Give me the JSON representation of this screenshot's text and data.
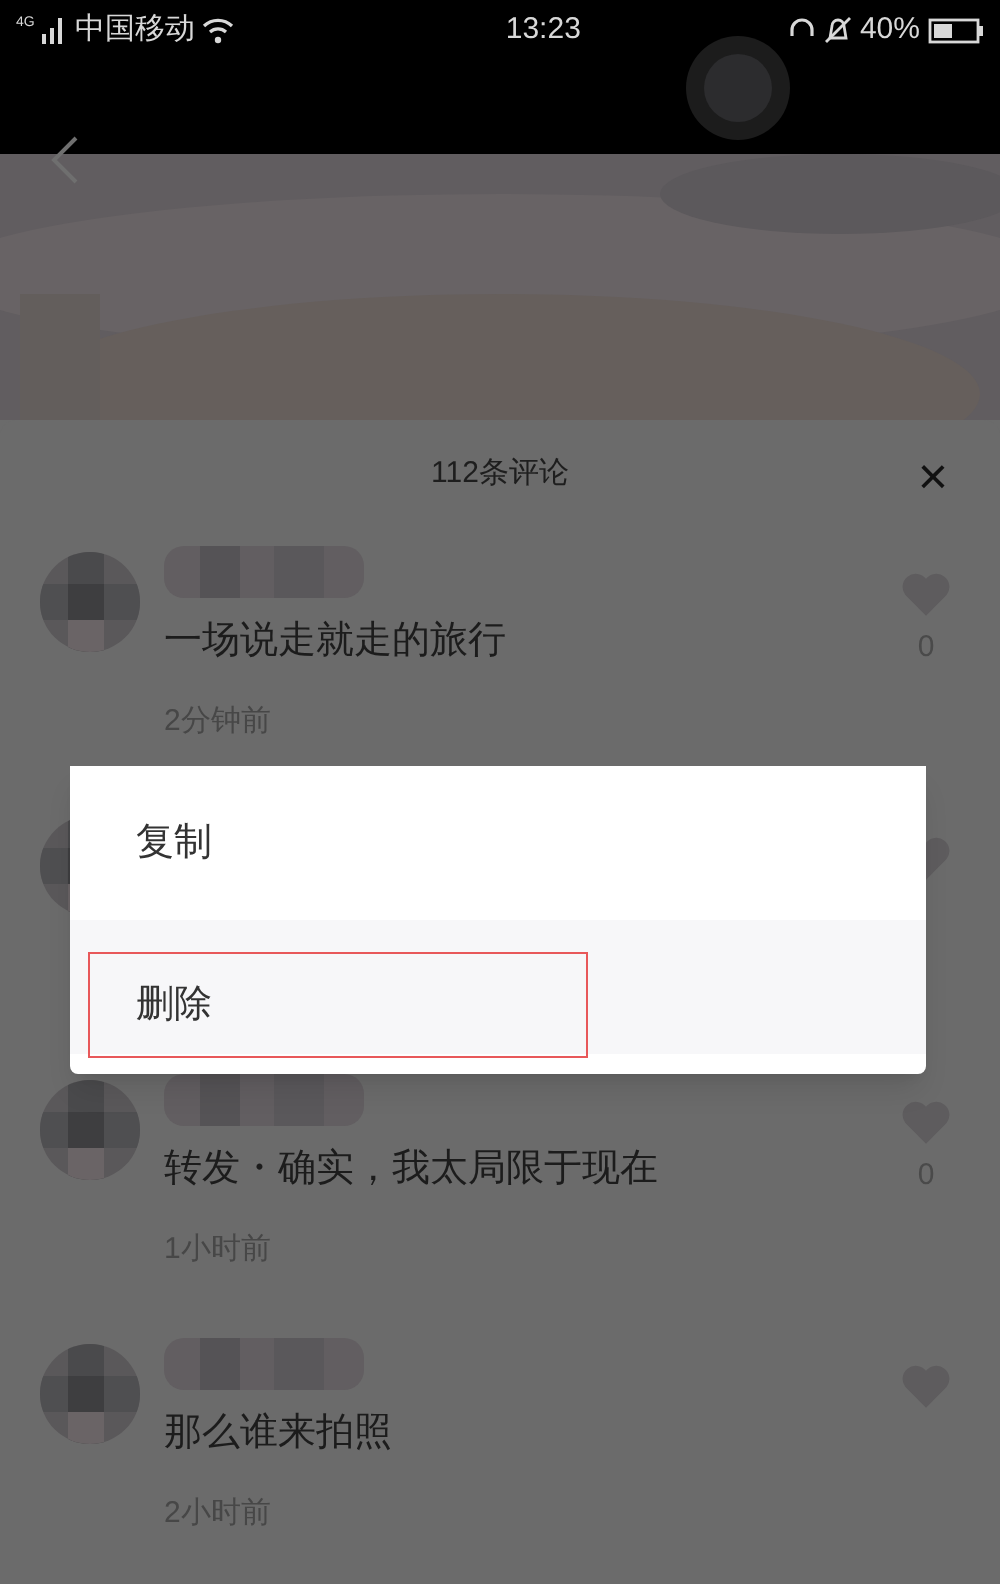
{
  "status_bar": {
    "network": "4G",
    "carrier": "中国移动",
    "time": "13:23",
    "battery": "40%"
  },
  "comments_sheet": {
    "title": "112条评论",
    "close": "×",
    "comments": [
      {
        "kind": "shown",
        "text": "一场说走就走的旅行",
        "time": "2分钟前",
        "likes": "0"
      },
      {
        "kind": "covered"
      },
      {
        "kind": "shown",
        "text": "转发・确实，我太局限于现在",
        "time": "1小时前",
        "likes": "0"
      },
      {
        "kind": "shown",
        "text": "那么谁来拍照",
        "time": "2小时前"
      }
    ]
  },
  "action_menu": {
    "items": [
      {
        "label": "复制",
        "selected": false
      },
      {
        "label": "删除",
        "selected": true
      }
    ]
  }
}
